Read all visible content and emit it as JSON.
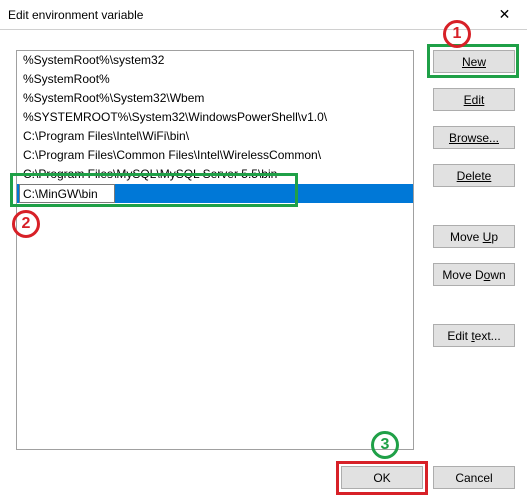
{
  "title": "Edit environment variable",
  "list": {
    "items": [
      "%SystemRoot%\\system32",
      "%SystemRoot%",
      "%SystemRoot%\\System32\\Wbem",
      "%SYSTEMROOT%\\System32\\WindowsPowerShell\\v1.0\\",
      "C:\\Program Files\\Intel\\WiFi\\bin\\",
      "C:\\Program Files\\Common Files\\Intel\\WirelessCommon\\",
      "C:\\Program Files\\MySQL\\MySQL Server 5.5\\bin",
      "C:\\MinGW\\bin"
    ],
    "selected_index": 7,
    "edit_value": "C:\\MinGW\\bin"
  },
  "buttons": {
    "new": "New",
    "edit": "Edit",
    "browse": "Browse...",
    "delete": "Delete",
    "moveup": "Move Up",
    "movedown": "Move Down",
    "edittext": "Edit text...",
    "ok": "OK",
    "cancel": "Cancel"
  },
  "annotations": {
    "n1": "1",
    "n2": "2",
    "n3": "3"
  }
}
